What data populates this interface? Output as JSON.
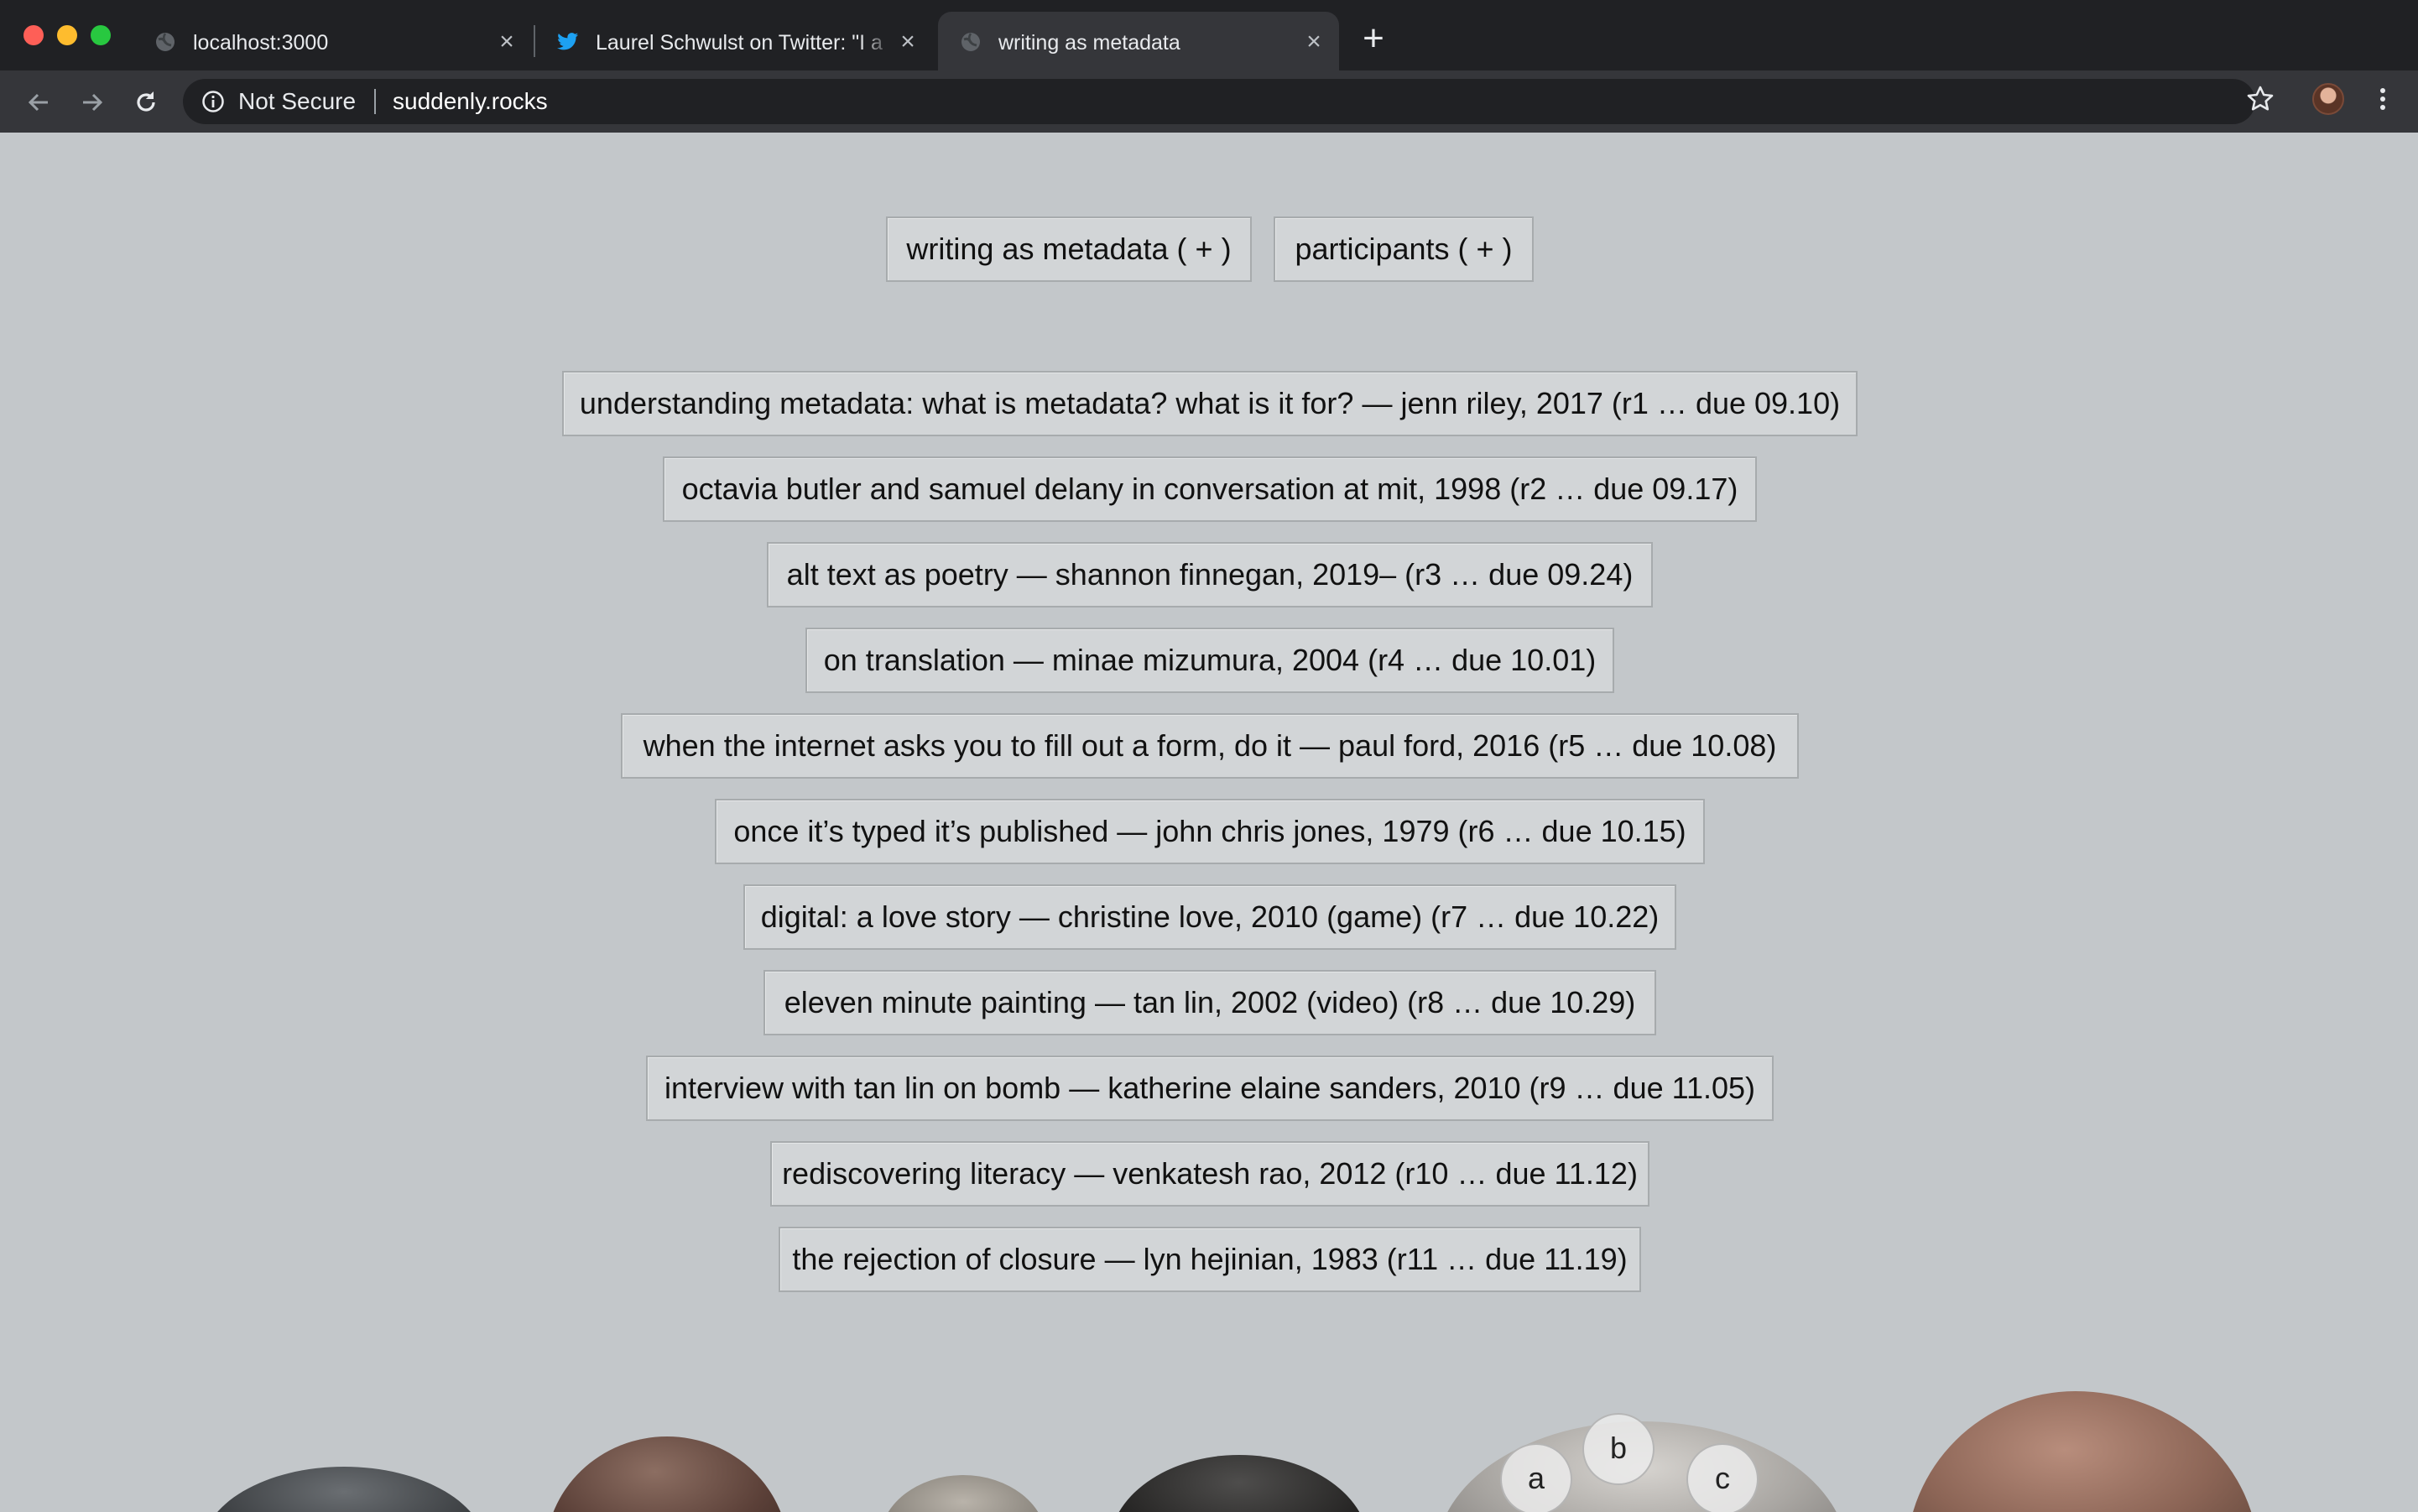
{
  "browser": {
    "tabs": [
      {
        "title": "localhost:3000",
        "icon": "globe-icon",
        "active": false
      },
      {
        "title": "Laurel Schwulst on Twitter: \"I a",
        "icon": "twitter-icon",
        "active": false
      },
      {
        "title": "writing as metadata",
        "icon": "globe-icon",
        "active": true
      }
    ],
    "new_tab_label": "+",
    "close_glyph": "×",
    "security_label": "Not Secure",
    "url": "suddenly.rocks"
  },
  "page": {
    "header_buttons": [
      {
        "label": "writing as metadata ( + )"
      },
      {
        "label": "participants ( + )"
      }
    ],
    "readings": [
      "understanding metadata: what is metadata? what is it for? — jenn riley, 2017 (r1 … due 09.10)",
      "octavia butler and samuel delany in conversation at mit, 1998 (r2 … due 09.17)",
      "alt text as poetry — shannon finnegan, 2019– (r3 … due 09.24)",
      "on translation — minae mizumura, 2004 (r4 … due 10.01)",
      "when the internet asks you to fill out a form, do it — paul ford, 2016 (r5 … due 10.08)",
      "once it’s typed it’s published — john chris jones, 1979 (r6 … due 10.15)",
      "digital: a love story — christine love, 2010 (game) (r7 … due 10.22)",
      "eleven minute painting — tan lin, 2002 (video) (r8 … due 10.29)",
      "interview with tan lin on bomb — katherine elaine sanders, 2010 (r9 … due 11.05)",
      "rediscovering literacy — venkatesh rao, 2012 (r10 … due 11.12)",
      "the rejection of closure — lyn hejinian, 1983 (r11 … due 11.19)"
    ],
    "rock_letters": [
      "a",
      "b",
      "c"
    ]
  }
}
